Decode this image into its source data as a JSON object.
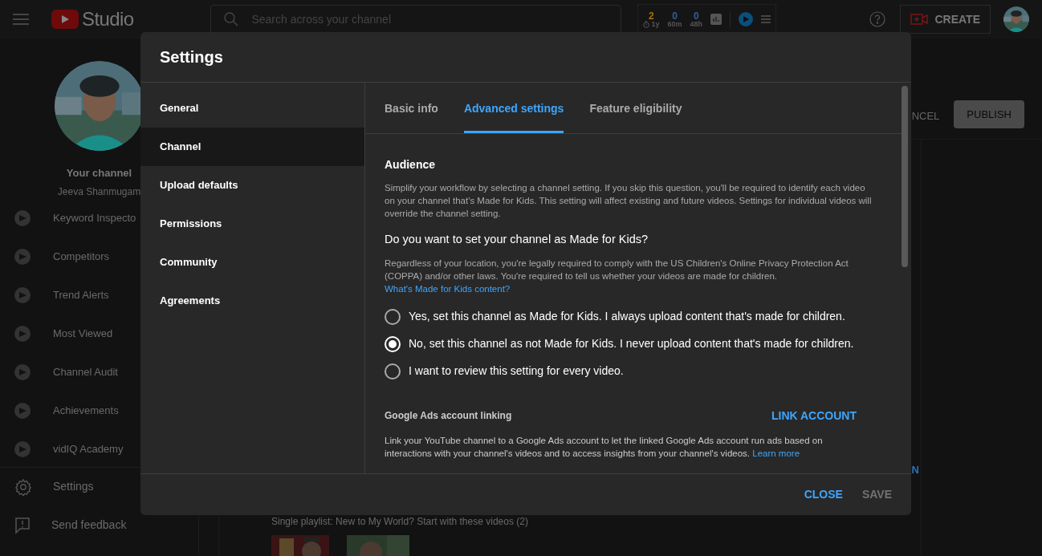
{
  "topbar": {
    "app_name": "Studio",
    "search": {
      "placeholder": "Search across your channel"
    },
    "stats": [
      {
        "value": "2",
        "label": "1y",
        "color": "#a87400",
        "clock": true
      },
      {
        "value": "0",
        "label": "60m",
        "color": "#2f5f9a",
        "clock": false
      },
      {
        "value": "0",
        "label": "48h",
        "color": "#2f5f9a",
        "clock": false
      }
    ],
    "create_button": "CREATE"
  },
  "sidebar": {
    "channel_title": "Your channel",
    "channel_name": "Jeeva Shanmugam",
    "items": [
      {
        "label": "Keyword Inspecto",
        "kind": "vidiq"
      },
      {
        "label": "Competitors",
        "kind": "vidiq"
      },
      {
        "label": "Trend Alerts",
        "kind": "vidiq"
      },
      {
        "label": "Most Viewed",
        "kind": "vidiq"
      },
      {
        "label": "Channel Audit",
        "kind": "vidiq"
      },
      {
        "label": "Achievements",
        "kind": "vidiq"
      },
      {
        "label": "vidIQ Academy",
        "kind": "vidiq"
      }
    ],
    "footer_items": [
      {
        "label": "Settings",
        "kind": "settings"
      },
      {
        "label": "Send feedback",
        "kind": "feedback"
      }
    ]
  },
  "page": {
    "cancel_button": "NCEL",
    "publish_button": "PUBLISH",
    "link_partial": "N",
    "playlist_title": "Single playlist: New to My World? Start with these videos (2)"
  },
  "dialog": {
    "title": "Settings",
    "nav": [
      {
        "label": "General",
        "selected": false
      },
      {
        "label": "Channel",
        "selected": true
      },
      {
        "label": "Upload defaults",
        "selected": false
      },
      {
        "label": "Permissions",
        "selected": false
      },
      {
        "label": "Community",
        "selected": false
      },
      {
        "label": "Agreements",
        "selected": false
      }
    ],
    "tabs": [
      {
        "label": "Basic info",
        "selected": false
      },
      {
        "label": "Advanced settings",
        "selected": true
      },
      {
        "label": "Feature eligibility",
        "selected": false
      }
    ],
    "audience": {
      "title": "Audience",
      "description": "Simplify your workflow by selecting a channel setting. If you skip this question, you'll be required to identify each video on your channel that's Made for Kids. This setting will affect existing and future videos. Settings for individual videos will override the channel setting.",
      "question": "Do you want to set your channel as Made for Kids?",
      "question_text": "Regardless of your location, you're legally required to comply with the US Children's Online Privacy Protection Act (COPPA) and/or other laws. You're required to tell us whether your videos are made for children.",
      "question_link": "What's Made for Kids content?",
      "options": [
        {
          "label": "Yes, set this channel as Made for Kids. I always upload content that's made for children.",
          "selected": false
        },
        {
          "label": "No, set this channel as not Made for Kids. I never upload content that's made for children.",
          "selected": true
        },
        {
          "label": "I want to review this setting for every video.",
          "selected": false
        }
      ]
    },
    "ads": {
      "title": "Google Ads account linking",
      "button": "LINK ACCOUNT",
      "description": "Link your YouTube channel to a Google Ads account to let the linked Google Ads account run ads based on interactions with your channel's videos and to access insights from your channel's videos.",
      "link": "Learn more"
    },
    "footer": [
      {
        "label": "CLOSE",
        "disabled": false
      },
      {
        "label": "SAVE",
        "disabled": true
      }
    ]
  }
}
